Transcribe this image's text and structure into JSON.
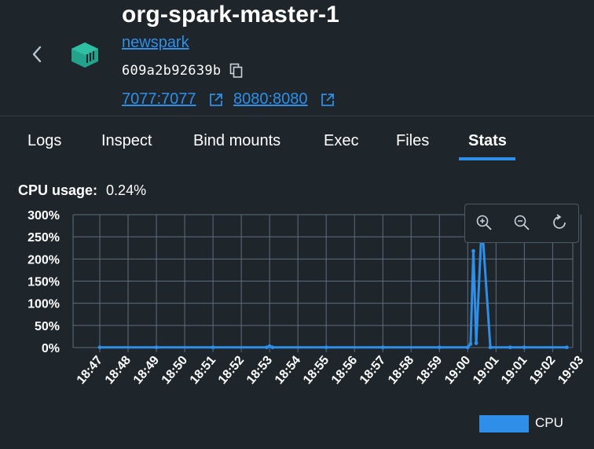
{
  "header": {
    "title": "org-spark-master-1",
    "image_link": "newspark",
    "container_id": "609a2b92639b",
    "ports": [
      "7077:7077",
      "8080:8080"
    ],
    "icons": {
      "back": "chevron-left-icon",
      "container": "container-icon",
      "copy": "copy-icon",
      "external": "external-link-icon"
    }
  },
  "tabs": [
    {
      "label": "Logs",
      "active": false
    },
    {
      "label": "Inspect",
      "active": false
    },
    {
      "label": "Bind mounts",
      "active": false
    },
    {
      "label": "Exec",
      "active": false
    },
    {
      "label": "Files",
      "active": false
    },
    {
      "label": "Stats",
      "active": true
    }
  ],
  "stats": {
    "cpu_label": "CPU usage:",
    "cpu_value": "0.24%"
  },
  "zoom_controls": {
    "icons": [
      "zoom-in-icon",
      "zoom-out-icon",
      "reset-zoom-icon"
    ]
  },
  "colors": {
    "accent": "#2f8fe8",
    "background": "#1e252b",
    "grid": "#5c6f7e",
    "container_icon": "#23a38b"
  },
  "chart_data": {
    "type": "line",
    "ylim": [
      0,
      300
    ],
    "y_ticks": [
      "0%",
      "50%",
      "100%",
      "150%",
      "200%",
      "250%",
      "300%"
    ],
    "x_ticks": [
      "18:47",
      "18:48",
      "18:49",
      "18:50",
      "18:51",
      "18:52",
      "18:53",
      "18:54",
      "18:55",
      "18:56",
      "18:57",
      "18:58",
      "18:59",
      "19:00",
      "19:01",
      "19:01",
      "19:02",
      "19:03"
    ],
    "grid": true,
    "legend_position": "bottom-right",
    "series": [
      {
        "name": "CPU",
        "points": [
          [
            "18:47",
            0.5
          ],
          [
            "18:49",
            0.5
          ],
          [
            "18:51",
            0.5
          ],
          [
            "18:52.9",
            0.5
          ],
          [
            "18:53.0",
            3
          ],
          [
            "18:53.1",
            0.5
          ],
          [
            "18:55",
            0.5
          ],
          [
            "18:57",
            0.5
          ],
          [
            "18:59",
            0.5
          ],
          [
            "19:00.0",
            0.5
          ],
          [
            "19:00.1",
            8
          ],
          [
            "19:00.2",
            218
          ],
          [
            "19:00.3",
            10
          ],
          [
            "19:00.5",
            282
          ],
          [
            "19:00.8",
            0.5
          ],
          [
            "19:01.5",
            0.5
          ],
          [
            "19:02",
            0.5
          ],
          [
            "19:03.5",
            0.5
          ]
        ]
      }
    ]
  }
}
